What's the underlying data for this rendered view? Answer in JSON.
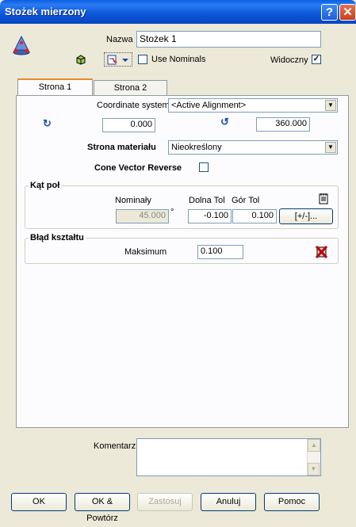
{
  "window": {
    "title": "Stożek mierzony"
  },
  "header": {
    "name_label": "Nazwa",
    "name_value": "Stożek 1",
    "use_nominals_label": "Use Nominals",
    "use_nominals_checked": false,
    "visible_label": "Widoczny",
    "visible_checked": true
  },
  "tabs": [
    {
      "label": "Strona 1",
      "active": true
    },
    {
      "label": "Strona 2",
      "active": false
    }
  ],
  "page1": {
    "coord_label": "Coordinate system",
    "coord_value": "<Active Alignment>",
    "angle_start": "0.000",
    "angle_end": "360.000",
    "material_label": "Strona materiału",
    "material_value": "Nieokreślony",
    "cone_reverse_label": "Cone Vector Reverse",
    "cone_reverse_checked": false,
    "angle_group": {
      "title": "Kąt poł",
      "nominal_label": "Nominały",
      "lower_tol_label": "Dolna Tol",
      "upper_tol_label": "Gór Tol",
      "nominal_value": "45.000",
      "degree_symbol": "°",
      "lower_tol_value": "-0.100",
      "upper_tol_value": "0.100",
      "plusminus_label": "[+/-]..."
    },
    "form_group": {
      "title": "Błąd kształtu",
      "max_label": "Maksimum",
      "max_value": "0.100"
    }
  },
  "comment": {
    "label": "Komentarz",
    "value": ""
  },
  "footer": {
    "ok": "OK",
    "ok_repeat": "OK & Powtórz",
    "apply": "Zastosuj",
    "cancel": "Anuluj",
    "help": "Pomoc"
  },
  "colors": {
    "titlebar": "#0a56d8",
    "dialog_bg": "#ece9d8",
    "tab_accent": "#e68b2c"
  }
}
